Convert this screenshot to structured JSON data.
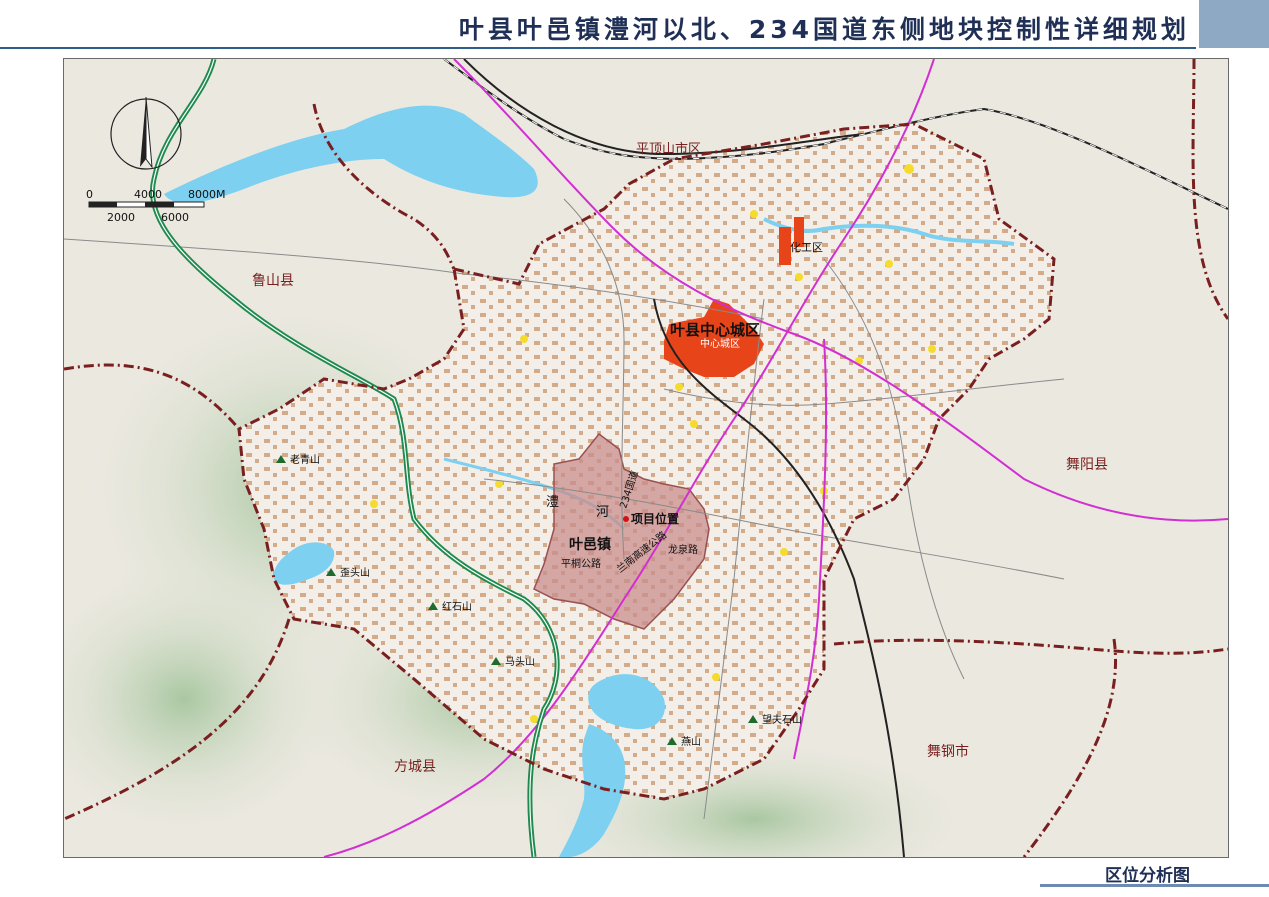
{
  "header": {
    "title": "叶县叶邑镇澧河以北、234国道东侧地块控制性详细规划"
  },
  "footer": {
    "label": "区位分析图"
  },
  "colors": {
    "county_boundary": "#7a1f1f",
    "highway": "#1e8a4e",
    "railway": "#222222",
    "expressway": "#d22fd2",
    "urban_core": "#e8441a",
    "project_area": "#c98d8d",
    "water": "#7dd0f0",
    "village": "#c89468",
    "town": "#f5dc2c"
  },
  "scale_bar": {
    "top_labels": [
      "0",
      "4000",
      "8000M"
    ],
    "bottom_labels": [
      "2000",
      "6000"
    ]
  },
  "regions": {
    "pingdingshan": "平顶山市区",
    "lushan": "鲁山县",
    "wuyang": "舞阳县",
    "fangcheng": "方城县",
    "wugang": "舞钢市"
  },
  "places": {
    "center_city": "叶县中心城区",
    "old_city": "中心城区",
    "chem_zone": "化工区",
    "yeyi": "叶邑镇",
    "project": "项目位置",
    "lihe_1": "澧",
    "lihe_2": "河",
    "g234": "234国道",
    "lannan": "兰南高速公路",
    "longquan": "龙泉路",
    "pingtong": "平桐公路"
  },
  "mountains": {
    "laoqing": "老青山",
    "waitou": "歪头山",
    "hongshi": "红石山",
    "matou": "马头山",
    "wangfushi": "望夫石山",
    "yan": "燕山"
  }
}
